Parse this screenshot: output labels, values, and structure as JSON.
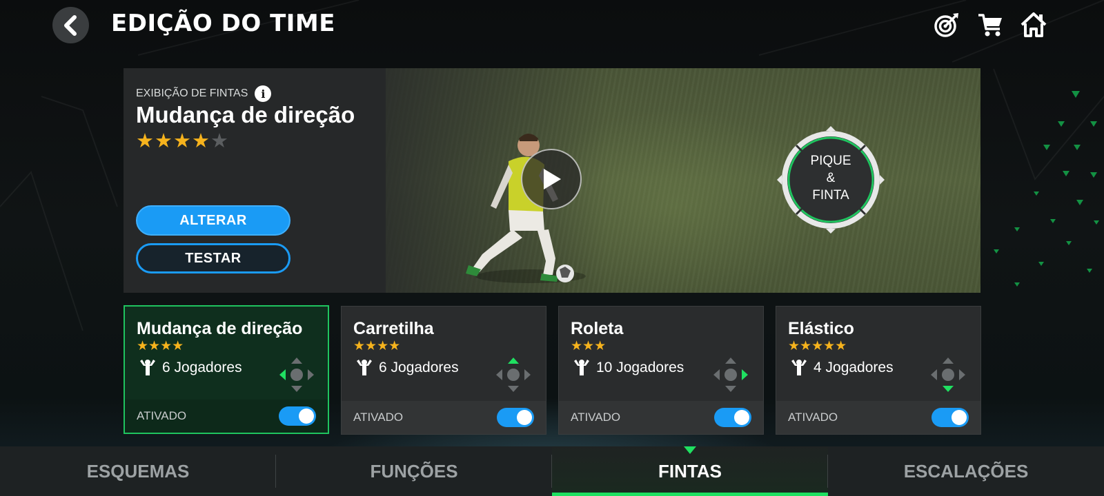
{
  "header": {
    "back_icon": "chevron-left-icon",
    "title": "EDIÇÃO DO TIME",
    "icons": [
      "target-icon",
      "cart-icon",
      "home-icon"
    ]
  },
  "hero": {
    "label": "EXIBIÇÃO DE FINTAS",
    "title": "Mudança de direção",
    "rating": 4,
    "max_rating": 5,
    "primary_button": "ALTERAR",
    "secondary_button": "TESTAR",
    "control_line1": "PIQUE",
    "control_line2": "&",
    "control_line3": "FINTA"
  },
  "cards": [
    {
      "name": "Mudança de direção",
      "stars": "★★★★",
      "players": "6 Jogadores",
      "direction": "left",
      "status": "ATIVADO",
      "selected": true
    },
    {
      "name": "Carretilha",
      "stars": "★★★★",
      "players": "6 Jogadores",
      "direction": "up",
      "status": "ATIVADO",
      "selected": false
    },
    {
      "name": "Roleta",
      "stars": "★★★",
      "players": "10 Jogadores",
      "direction": "right",
      "status": "ATIVADO",
      "selected": false
    },
    {
      "name": "Elástico",
      "stars": "★★★★★",
      "players": "4 Jogadores",
      "direction": "down",
      "status": "ATIVADO",
      "selected": false
    }
  ],
  "tabs": [
    {
      "label": "ESQUEMAS",
      "active": false
    },
    {
      "label": "FUNÇÕES",
      "active": false
    },
    {
      "label": "FINTAS",
      "active": true
    },
    {
      "label": "ESCALAÇÕES",
      "active": false
    }
  ],
  "colors": {
    "accent_green": "#1fe061",
    "button_blue": "#1a9bf5",
    "star_gold": "#f6b31d"
  }
}
